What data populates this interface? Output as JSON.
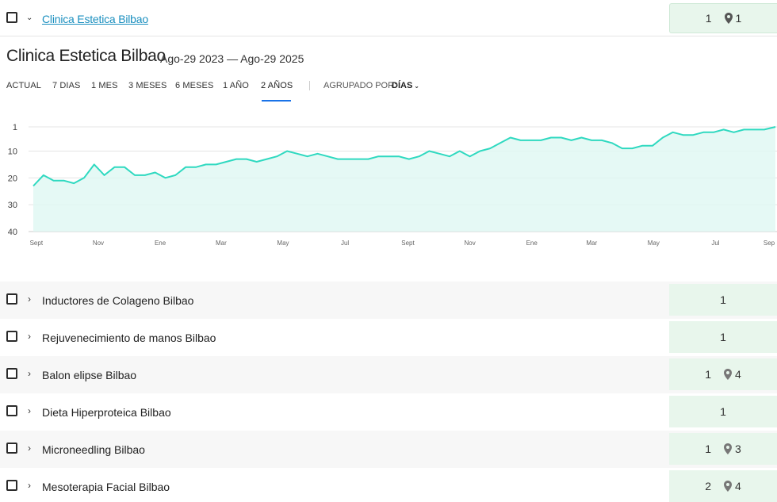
{
  "top_row": {
    "name": "Clinica Estetica Bilbao",
    "rank": "1",
    "local_rank": "1"
  },
  "header": {
    "title": "Clinica Estetica Bilbao",
    "date_range": "Ago-29 2023 — Ago-29 2025"
  },
  "tabs": [
    "ACTUAL",
    "7 DIAS",
    "1 MES",
    "3 MESES",
    "6 MESES",
    "1 AÑO",
    "2 AÑOS"
  ],
  "active_tab": "2 AÑOS",
  "grouping": {
    "label": "AGRUPADO POR:",
    "value": "DÍAS"
  },
  "colors": {
    "line": "#2fd9c0",
    "fill": "#dff8f3",
    "rank_bg": "#e8f6ec",
    "link": "#1a8fbf",
    "tab_underline": "#1a73e8"
  },
  "chart_data": {
    "type": "area",
    "title": "",
    "xlabel": "",
    "ylabel": "",
    "y_inverted": true,
    "ylim": [
      1,
      40
    ],
    "y_ticks": [
      "1",
      "10",
      "20",
      "30",
      "40"
    ],
    "x_ticks": [
      "Sept",
      "Nov",
      "Ene",
      "Mar",
      "May",
      "Jul",
      "Sept",
      "Nov",
      "Ene",
      "Mar",
      "May",
      "Jul",
      "Sep"
    ],
    "grid": true,
    "series": [
      {
        "x": [
          "2023-08-29",
          "2023-09-08",
          "2023-09-18",
          "2023-09-28",
          "2023-10-08",
          "2023-10-18",
          "2023-10-28",
          "2023-11-07",
          "2023-11-17",
          "2023-11-27",
          "2023-12-07",
          "2023-12-17",
          "2023-12-27",
          "2024-01-06",
          "2024-01-16",
          "2024-01-26",
          "2024-02-05",
          "2024-02-15",
          "2024-02-25",
          "2024-03-06",
          "2024-03-16",
          "2024-03-26",
          "2024-04-05",
          "2024-04-15",
          "2024-04-25",
          "2024-05-05",
          "2024-05-15",
          "2024-05-25",
          "2024-06-04",
          "2024-06-14",
          "2024-06-24",
          "2024-07-04",
          "2024-07-14",
          "2024-07-24",
          "2024-08-03",
          "2024-08-13",
          "2024-08-23",
          "2024-09-02",
          "2024-09-12",
          "2024-09-22",
          "2024-10-02",
          "2024-10-12",
          "2024-10-22",
          "2024-11-01",
          "2024-11-11",
          "2024-11-21",
          "2024-12-01",
          "2024-12-11",
          "2024-12-21",
          "2024-12-31",
          "2025-01-10",
          "2025-01-20",
          "2025-01-30",
          "2025-02-09",
          "2025-02-19",
          "2025-03-01",
          "2025-03-11",
          "2025-03-21",
          "2025-03-31",
          "2025-04-10",
          "2025-04-20",
          "2025-04-30",
          "2025-05-10",
          "2025-05-20",
          "2025-05-30",
          "2025-06-09",
          "2025-06-19",
          "2025-06-29",
          "2025-07-09",
          "2025-07-19",
          "2025-07-29",
          "2025-08-08",
          "2025-08-18",
          "2025-08-29"
        ],
        "values": [
          23,
          19,
          21,
          21,
          22,
          20,
          15,
          19,
          16,
          16,
          19,
          19,
          18,
          20,
          19,
          16,
          16,
          15,
          15,
          14,
          13,
          13,
          14,
          13,
          12,
          10,
          11,
          12,
          11,
          12,
          13,
          13,
          13,
          13,
          12,
          12,
          12,
          13,
          12,
          10,
          11,
          12,
          10,
          12,
          10,
          9,
          7,
          5,
          6,
          6,
          6,
          5,
          5,
          6,
          5,
          6,
          6,
          7,
          9,
          9,
          8,
          8,
          5,
          3,
          4,
          4,
          3,
          3,
          2,
          3,
          2,
          2,
          2,
          1
        ]
      }
    ]
  },
  "keywords": [
    {
      "label": "Inductores de Colageno Bilbao",
      "rank": "1",
      "local": ""
    },
    {
      "label": "Rejuvenecimiento de manos Bilbao",
      "rank": "1",
      "local": ""
    },
    {
      "label": "Balon elipse Bilbao",
      "rank": "1",
      "local": "4"
    },
    {
      "label": "Dieta Hiperproteica Bilbao",
      "rank": "1",
      "local": ""
    },
    {
      "label": "Microneedling Bilbao",
      "rank": "1",
      "local": "3"
    },
    {
      "label": "Mesoterapia Facial Bilbao",
      "rank": "2",
      "local": "4"
    }
  ]
}
